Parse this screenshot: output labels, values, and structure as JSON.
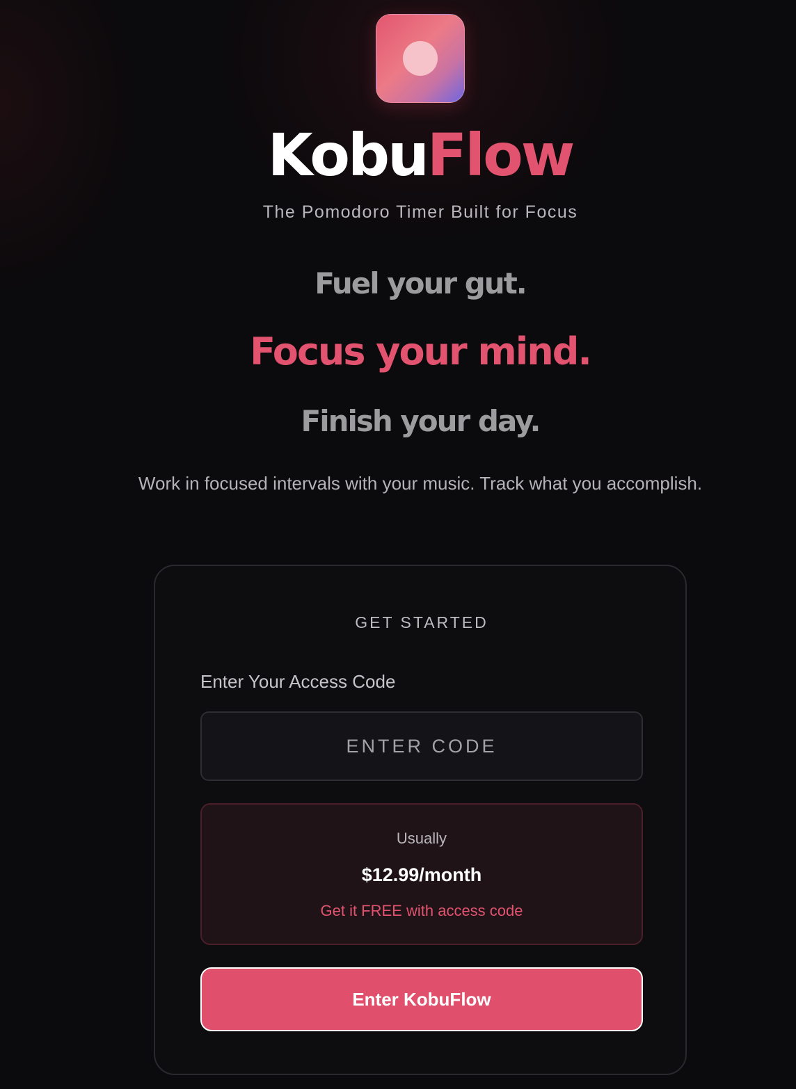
{
  "brand": {
    "name_part_1": "Kobu",
    "name_part_2": "Flow",
    "tagline": "The Pomodoro Timer Built for Focus",
    "colors": {
      "accent": "#e2536f",
      "logo_gradient": [
        "#e2566f",
        "#ec7a86",
        "#6f66e0"
      ]
    }
  },
  "hero": {
    "line_1": "Fuel your gut.",
    "line_2": "Focus your mind.",
    "line_3": "Finish your day.",
    "subtitle": "Work in focused intervals with your music. Track what you accomplish."
  },
  "card": {
    "heading": "GET STARTED",
    "field_label": "Enter Your Access Code",
    "code_input": {
      "placeholder": "ENTER CODE",
      "value": ""
    },
    "pricing": {
      "usually_label": "Usually",
      "price": "$12.99/month",
      "offer": "Get it FREE with access code"
    },
    "submit_label": "Enter KobuFlow"
  }
}
